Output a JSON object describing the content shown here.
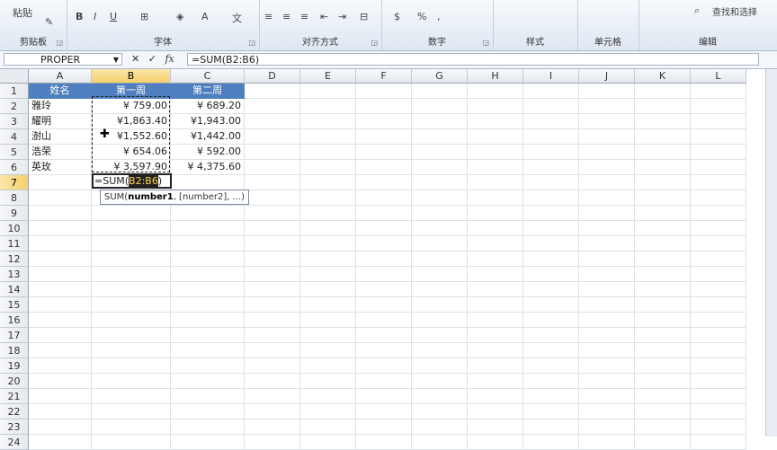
{
  "ribbon": {
    "clipboard": {
      "paste": "粘贴",
      "label": "剪贴板"
    },
    "font": {
      "bold": "B",
      "italic": "I",
      "underline": "U",
      "font_color": "A",
      "label": "字体"
    },
    "alignment": {
      "label": "对齐方式"
    },
    "number": {
      "currency": "$",
      "percent": "%",
      "comma": ",",
      "label": "数字"
    },
    "styles": {
      "label": "样式"
    },
    "cells": {
      "label": "单元格"
    },
    "editing": {
      "find_select": "查找和选择",
      "label": "编辑"
    }
  },
  "formula_bar": {
    "name_box": "PROPER",
    "cancel": "✕",
    "enter": "✓",
    "fx": "fx",
    "formula": "=SUM(B2:B6)"
  },
  "columns": [
    "A",
    "B",
    "C",
    "D",
    "E",
    "F",
    "G",
    "H",
    "I",
    "J",
    "K",
    "L"
  ],
  "rows": [
    "1",
    "2",
    "3",
    "4",
    "5",
    "6",
    "7",
    "8",
    "9",
    "10",
    "11",
    "12",
    "13",
    "14",
    "15",
    "16",
    "17",
    "18",
    "19",
    "20",
    "21",
    "22",
    "23",
    "24"
  ],
  "table": {
    "headers": [
      "姓名",
      "第一周",
      "第二周"
    ],
    "data": [
      [
        "雅玲",
        "¥ 759.00",
        "¥ 689.20"
      ],
      [
        "耀明",
        "¥1,863.40",
        "¥1,943.00"
      ],
      [
        "澍山",
        "¥1,552.60",
        "¥1,442.00"
      ],
      [
        "浩荣",
        "¥ 654.06",
        "¥ 592.00"
      ],
      [
        "英玫",
        "¥ 3,597.90",
        "¥ 4,375.60"
      ]
    ]
  },
  "edit_cell": {
    "prefix": "=SUM(",
    "ref": "B2:B6",
    "suffix": ")"
  },
  "tooltip": {
    "fn": "SUM(",
    "arg1": "number1",
    "rest": ", [number2], ...)"
  },
  "colors": {
    "header_fill": "#4f7fbf",
    "selected_header": "#f5cf6b"
  }
}
